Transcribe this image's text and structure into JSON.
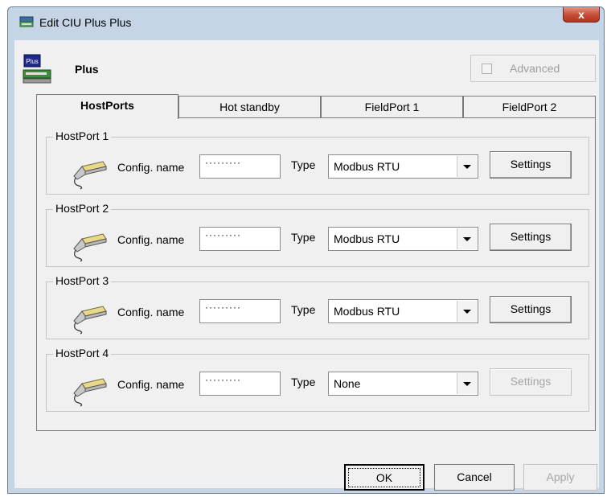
{
  "window": {
    "title": "Edit CIU Plus Plus",
    "close_label": "x"
  },
  "device": {
    "name": "Plus",
    "icon_label": "Plus"
  },
  "advanced": {
    "label": "Advanced",
    "checked": false,
    "enabled": false
  },
  "tabs": [
    {
      "label": "HostPorts",
      "active": true
    },
    {
      "label": "Hot standby",
      "active": false
    },
    {
      "label": "FieldPort 1",
      "active": false
    },
    {
      "label": "FieldPort 2",
      "active": false
    }
  ],
  "host_ports": [
    {
      "title": "HostPort 1",
      "config_label": "Config. name",
      "config_value": "·········",
      "type_label": "Type",
      "type_value": "Modbus RTU",
      "settings_label": "Settings",
      "settings_enabled": true
    },
    {
      "title": "HostPort 2",
      "config_label": "Config. name",
      "config_value": "·········",
      "type_label": "Type",
      "type_value": "Modbus RTU",
      "settings_label": "Settings",
      "settings_enabled": true
    },
    {
      "title": "HostPort 3",
      "config_label": "Config. name",
      "config_value": "·········",
      "type_label": "Type",
      "type_value": "Modbus RTU",
      "settings_label": "Settings",
      "settings_enabled": true
    },
    {
      "title": "HostPort 4",
      "config_label": "Config. name",
      "config_value": "·········",
      "type_label": "Type",
      "type_value": "None",
      "settings_label": "Settings",
      "settings_enabled": false
    }
  ],
  "buttons": {
    "ok": "OK",
    "cancel": "Cancel",
    "apply": "Apply"
  },
  "colors": {
    "window_frame": "#c6d5e6",
    "client_bg": "#f0f0f0",
    "close_button": "#c7503b",
    "disabled_text": "#a6a6a6"
  },
  "icons": {
    "app": "ciu-device-icon",
    "device": "plus-device-icon",
    "port": "serial-connector-icon"
  }
}
